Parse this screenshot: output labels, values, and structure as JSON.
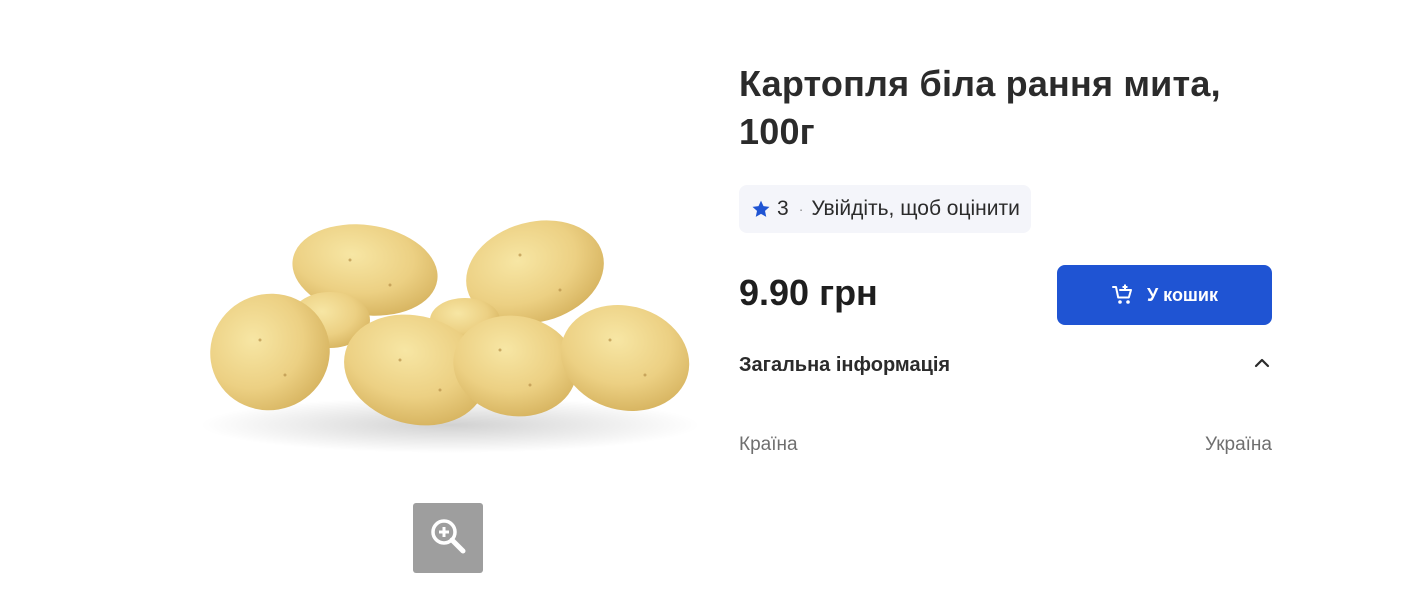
{
  "product": {
    "title": "Картопля біла рання мита, 100г",
    "image_alt": "potatoes-image"
  },
  "rating": {
    "value": "3",
    "separator": "·",
    "login_prompt": "Увійдіть, щоб оцінити",
    "star_color": "#1f54d3"
  },
  "price": {
    "text": "9.90 грн"
  },
  "cart": {
    "button_label": "У кошик",
    "color": "#1f54d3"
  },
  "general_info": {
    "title": "Загальна інформація",
    "rows": [
      {
        "label": "Країна",
        "value": "Україна"
      }
    ]
  },
  "icons": {
    "zoom": "zoom-in-icon",
    "star": "star-icon",
    "cart": "cart-add-icon",
    "chevron": "chevron-up-icon"
  }
}
